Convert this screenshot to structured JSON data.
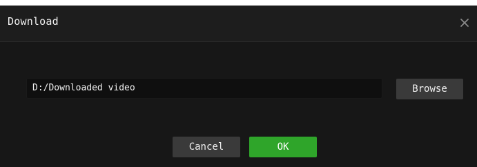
{
  "dialog": {
    "title": "Download",
    "close_icon": "close-icon",
    "path_field": {
      "value": "D:/Downloaded video"
    },
    "buttons": {
      "browse": "Browse",
      "cancel": "Cancel",
      "ok": "OK"
    },
    "colors": {
      "background": "#171717",
      "titlebar": "#1d1d1d",
      "button": "#3a3a3a",
      "primary": "#2fa52a"
    }
  }
}
